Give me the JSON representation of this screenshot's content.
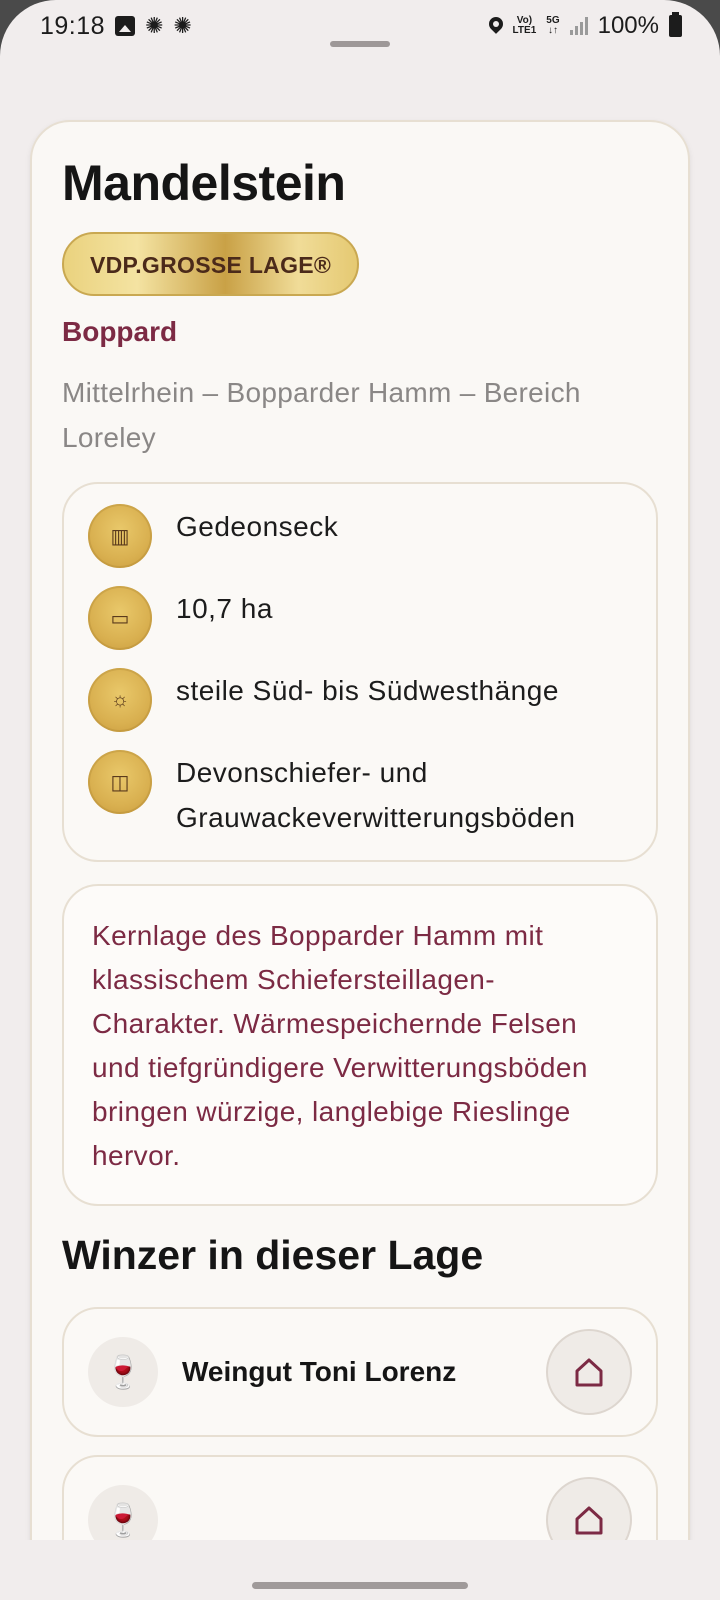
{
  "status_bar": {
    "time": "19:18",
    "volte": "Vo)",
    "lte": "LTE1",
    "network": "5G",
    "battery": "100%"
  },
  "lage": {
    "name": "Mandelstein",
    "badge": "VDP.GROSSE LAGE®",
    "place": "Boppard",
    "region": "Mittelrhein – Bopparder Hamm – Bereich Loreley"
  },
  "facts": [
    {
      "icon": "vineyard-icon",
      "glyph": "▥",
      "text": "Gedeonseck"
    },
    {
      "icon": "area-icon",
      "glyph": "▭",
      "text": "10,7 ha"
    },
    {
      "icon": "sun-icon",
      "glyph": "☼",
      "text": "steile Süd- bis Südwesthänge"
    },
    {
      "icon": "soil-icon",
      "glyph": "◫",
      "text": "Devonschiefer- und Grauwackeverwitterungsböden"
    }
  ],
  "description": "Kernlage des Bopparder Hamm mit klassischem Schiefersteillagen-Charakter. Wärmespeichernde Felsen und tiefgründigere Verwitterungsböden bringen würzige, langlebige Rieslinge hervor.",
  "winzer_section": {
    "title": "Winzer in dieser Lage",
    "items": [
      {
        "name": "Weingut Toni Lorenz",
        "icon": "wine-glass-icon",
        "glyph": "🍷"
      },
      {
        "name": "",
        "icon": "wine-glass-icon",
        "glyph": "🍷"
      }
    ]
  },
  "colors": {
    "accent": "#7c2a44",
    "gold": "#d9b050",
    "background": "#f1eded",
    "card": "#faf8f5"
  }
}
